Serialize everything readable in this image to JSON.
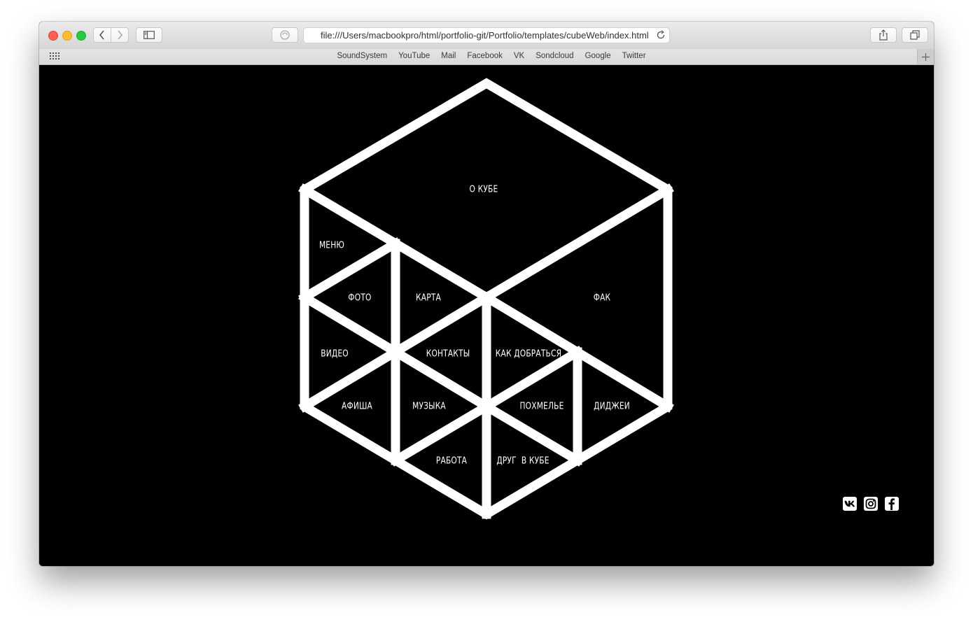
{
  "browser": {
    "url": "file:///Users/macbookpro/html/portfolio-git/Portfolio/templates/cubeWeb/index.html",
    "favorites": [
      "SoundSystem",
      "YouTube",
      "Mail",
      "Facebook",
      "VK",
      "Sondcloud",
      "Google",
      "Twitter"
    ]
  },
  "cube": {
    "stroke_color": "#ffffff",
    "background_color": "#000000",
    "labels": {
      "about": "О КУБЕ",
      "menu": "МЕНЮ",
      "photo": "ФОТО",
      "map": "КАРТА",
      "faq": "ФАК",
      "video": "ВИДЕО",
      "contacts": "КОНТАКТЫ",
      "directions": "КАК ДОБРАТЬСЯ",
      "poster": "АФИША",
      "music": "МУЗЫКА",
      "hangover": "ПОХМЕЛЬЕ",
      "djs": "ДИДЖЕИ",
      "work": "РАБОТА",
      "friend": "ДРУГ  В КУБЕ"
    }
  },
  "social": {
    "icons": [
      "vk-icon",
      "instagram-icon",
      "facebook-icon"
    ]
  }
}
